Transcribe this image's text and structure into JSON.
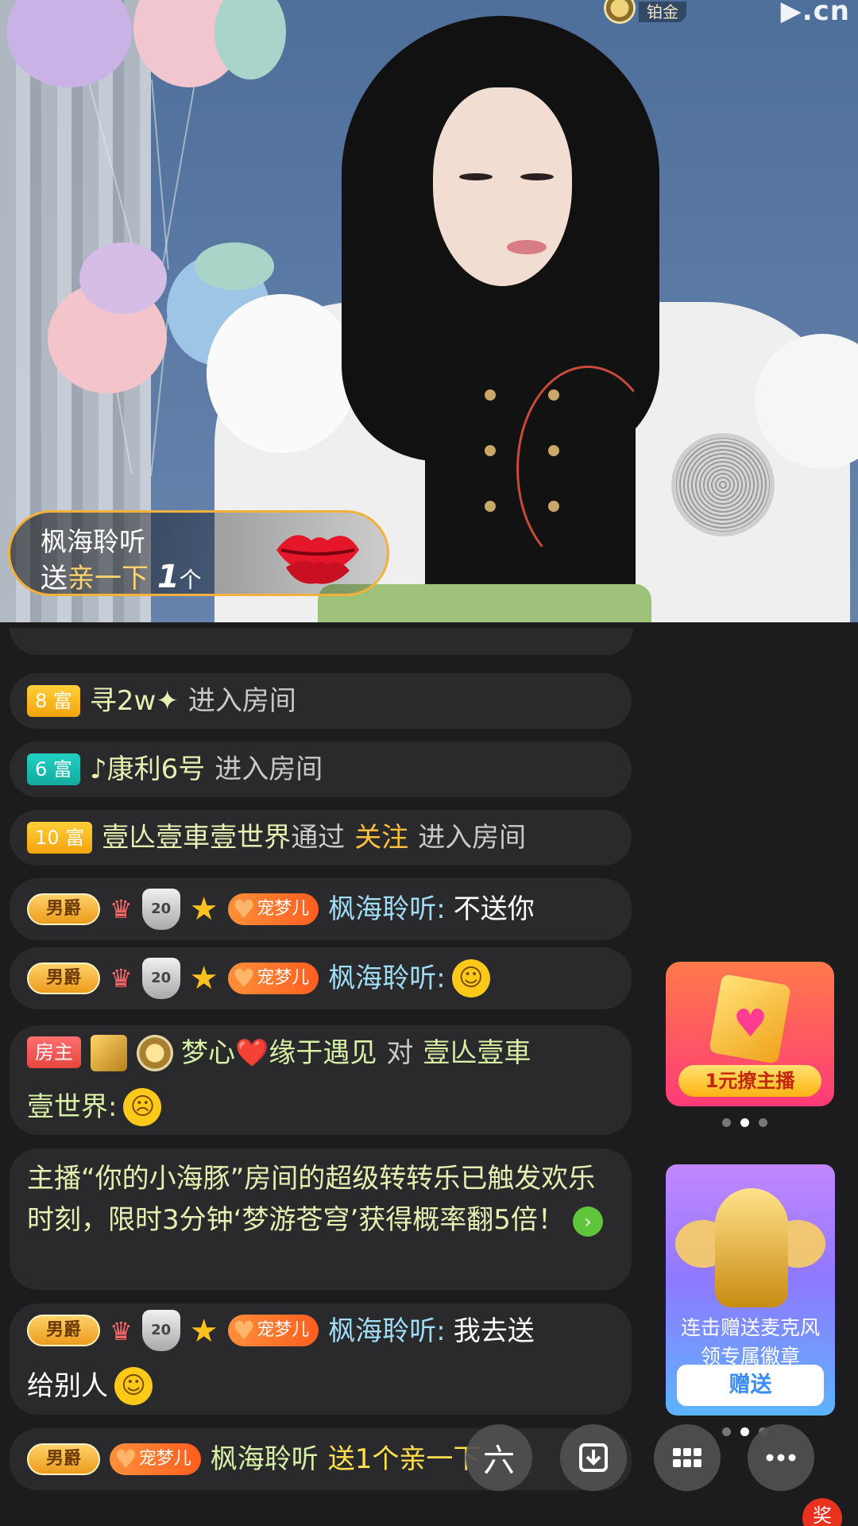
{
  "stream": {
    "top_badge_label": "铂金",
    "watermark": "▶.cn"
  },
  "gift_banner": {
    "user": "枫海聆听",
    "send_word": "送",
    "gift_name": "亲一下",
    "count": "1",
    "unit": "个"
  },
  "chat": [
    {
      "level": "8",
      "rank": "富",
      "name": "寻2w✦",
      "action": "进入房间"
    },
    {
      "level": "6",
      "rank": "富",
      "name": "♪康利6号",
      "action": "进入房间"
    },
    {
      "level": "10",
      "rank": "富",
      "name": "壹亾壹車壹世界",
      "via": "通过",
      "follow": "关注",
      "action": "进入房间"
    },
    {
      "badge": "男爵",
      "fan_badge": "宠梦儿",
      "shield_num": "20",
      "name": "枫海聆听:",
      "message": "不送你"
    },
    {
      "badge": "男爵",
      "fan_badge": "宠梦儿",
      "shield_num": "20",
      "name": "枫海聆听:",
      "message": ""
    },
    {
      "host_badge": "房主",
      "name": "梦心❤️缘于遇见",
      "to": "对",
      "target": "壹亾壹車",
      "target2": "壹世界:"
    },
    {
      "system": "主播“你的小海豚”房间的超级转转乐已触发欢乐时刻，限时3分钟‘梦游苍穹’获得概率翻5倍！"
    },
    {
      "badge": "男爵",
      "fan_badge": "宠梦儿",
      "shield_num": "20",
      "name": "枫海聆听:",
      "message": "我去送",
      "message2": "给别人"
    },
    {
      "badge": "男爵",
      "fan_badge": "宠梦儿",
      "name": "枫海聆听",
      "gift_text": "送1个亲一下"
    }
  ],
  "ads": {
    "ad1_caption": "1元撩主播",
    "ad2_line1": "连击赠送麦克风",
    "ad2_line2": "领专属徽章",
    "ad2_button": "赠送"
  },
  "bottom": {
    "six_label": "六",
    "prize_label": "奖"
  },
  "colors": {
    "accent_gold": "#ffbf3a",
    "chat_bg": "#2a2a2c",
    "page_bg": "#1c1c1e"
  }
}
